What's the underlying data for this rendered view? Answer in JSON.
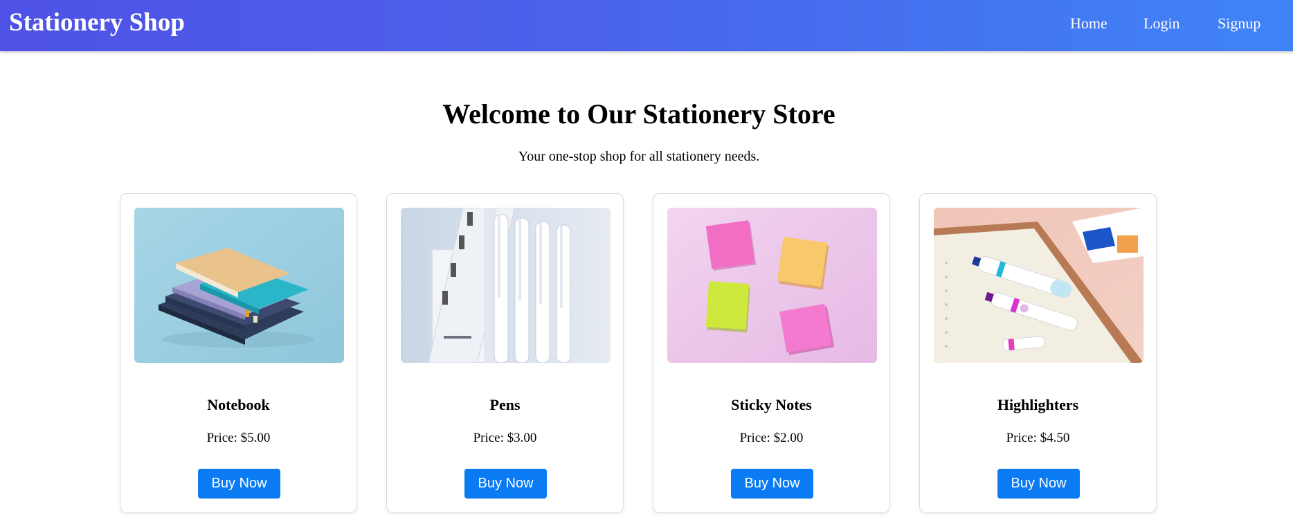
{
  "header": {
    "brand": "Stationery Shop",
    "nav": [
      "Home",
      "Login",
      "Signup"
    ]
  },
  "hero": {
    "title": "Welcome to Our Stationery Store",
    "subtitle": "Your one-stop shop for all stationery needs."
  },
  "products": [
    {
      "name": "Notebook",
      "price": "Price: $5.00",
      "button": "Buy Now",
      "image": "notebooks-photo"
    },
    {
      "name": "Pens",
      "price": "Price: $3.00",
      "button": "Buy Now",
      "image": "pens-photo"
    },
    {
      "name": "Sticky Notes",
      "price": "Price: $2.00",
      "button": "Buy Now",
      "image": "sticky-notes-photo"
    },
    {
      "name": "Highlighters",
      "price": "Price: $4.50",
      "button": "Buy Now",
      "image": "highlighters-photo"
    }
  ],
  "colors": {
    "header_gradient_start": "#4f52e6",
    "header_gradient_end": "#3f84f6",
    "button": "#0a7bf2"
  }
}
